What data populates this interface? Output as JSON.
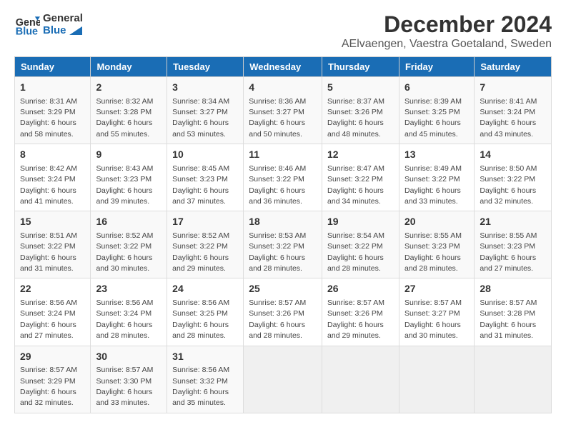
{
  "header": {
    "logo_line1": "General",
    "logo_line2": "Blue",
    "month_title": "December 2024",
    "subtitle": "AElvaengen, Vaestra Goetaland, Sweden"
  },
  "columns": [
    "Sunday",
    "Monday",
    "Tuesday",
    "Wednesday",
    "Thursday",
    "Friday",
    "Saturday"
  ],
  "weeks": [
    [
      {
        "day": "1",
        "info": "Sunrise: 8:31 AM\nSunset: 3:29 PM\nDaylight: 6 hours\nand 58 minutes."
      },
      {
        "day": "2",
        "info": "Sunrise: 8:32 AM\nSunset: 3:28 PM\nDaylight: 6 hours\nand 55 minutes."
      },
      {
        "day": "3",
        "info": "Sunrise: 8:34 AM\nSunset: 3:27 PM\nDaylight: 6 hours\nand 53 minutes."
      },
      {
        "day": "4",
        "info": "Sunrise: 8:36 AM\nSunset: 3:27 PM\nDaylight: 6 hours\nand 50 minutes."
      },
      {
        "day": "5",
        "info": "Sunrise: 8:37 AM\nSunset: 3:26 PM\nDaylight: 6 hours\nand 48 minutes."
      },
      {
        "day": "6",
        "info": "Sunrise: 8:39 AM\nSunset: 3:25 PM\nDaylight: 6 hours\nand 45 minutes."
      },
      {
        "day": "7",
        "info": "Sunrise: 8:41 AM\nSunset: 3:24 PM\nDaylight: 6 hours\nand 43 minutes."
      }
    ],
    [
      {
        "day": "8",
        "info": "Sunrise: 8:42 AM\nSunset: 3:24 PM\nDaylight: 6 hours\nand 41 minutes."
      },
      {
        "day": "9",
        "info": "Sunrise: 8:43 AM\nSunset: 3:23 PM\nDaylight: 6 hours\nand 39 minutes."
      },
      {
        "day": "10",
        "info": "Sunrise: 8:45 AM\nSunset: 3:23 PM\nDaylight: 6 hours\nand 37 minutes."
      },
      {
        "day": "11",
        "info": "Sunrise: 8:46 AM\nSunset: 3:22 PM\nDaylight: 6 hours\nand 36 minutes."
      },
      {
        "day": "12",
        "info": "Sunrise: 8:47 AM\nSunset: 3:22 PM\nDaylight: 6 hours\nand 34 minutes."
      },
      {
        "day": "13",
        "info": "Sunrise: 8:49 AM\nSunset: 3:22 PM\nDaylight: 6 hours\nand 33 minutes."
      },
      {
        "day": "14",
        "info": "Sunrise: 8:50 AM\nSunset: 3:22 PM\nDaylight: 6 hours\nand 32 minutes."
      }
    ],
    [
      {
        "day": "15",
        "info": "Sunrise: 8:51 AM\nSunset: 3:22 PM\nDaylight: 6 hours\nand 31 minutes."
      },
      {
        "day": "16",
        "info": "Sunrise: 8:52 AM\nSunset: 3:22 PM\nDaylight: 6 hours\nand 30 minutes."
      },
      {
        "day": "17",
        "info": "Sunrise: 8:52 AM\nSunset: 3:22 PM\nDaylight: 6 hours\nand 29 minutes."
      },
      {
        "day": "18",
        "info": "Sunrise: 8:53 AM\nSunset: 3:22 PM\nDaylight: 6 hours\nand 28 minutes."
      },
      {
        "day": "19",
        "info": "Sunrise: 8:54 AM\nSunset: 3:22 PM\nDaylight: 6 hours\nand 28 minutes."
      },
      {
        "day": "20",
        "info": "Sunrise: 8:55 AM\nSunset: 3:23 PM\nDaylight: 6 hours\nand 28 minutes."
      },
      {
        "day": "21",
        "info": "Sunrise: 8:55 AM\nSunset: 3:23 PM\nDaylight: 6 hours\nand 27 minutes."
      }
    ],
    [
      {
        "day": "22",
        "info": "Sunrise: 8:56 AM\nSunset: 3:24 PM\nDaylight: 6 hours\nand 27 minutes."
      },
      {
        "day": "23",
        "info": "Sunrise: 8:56 AM\nSunset: 3:24 PM\nDaylight: 6 hours\nand 28 minutes."
      },
      {
        "day": "24",
        "info": "Sunrise: 8:56 AM\nSunset: 3:25 PM\nDaylight: 6 hours\nand 28 minutes."
      },
      {
        "day": "25",
        "info": "Sunrise: 8:57 AM\nSunset: 3:26 PM\nDaylight: 6 hours\nand 28 minutes."
      },
      {
        "day": "26",
        "info": "Sunrise: 8:57 AM\nSunset: 3:26 PM\nDaylight: 6 hours\nand 29 minutes."
      },
      {
        "day": "27",
        "info": "Sunrise: 8:57 AM\nSunset: 3:27 PM\nDaylight: 6 hours\nand 30 minutes."
      },
      {
        "day": "28",
        "info": "Sunrise: 8:57 AM\nSunset: 3:28 PM\nDaylight: 6 hours\nand 31 minutes."
      }
    ],
    [
      {
        "day": "29",
        "info": "Sunrise: 8:57 AM\nSunset: 3:29 PM\nDaylight: 6 hours\nand 32 minutes."
      },
      {
        "day": "30",
        "info": "Sunrise: 8:57 AM\nSunset: 3:30 PM\nDaylight: 6 hours\nand 33 minutes."
      },
      {
        "day": "31",
        "info": "Sunrise: 8:56 AM\nSunset: 3:32 PM\nDaylight: 6 hours\nand 35 minutes."
      },
      null,
      null,
      null,
      null
    ]
  ]
}
